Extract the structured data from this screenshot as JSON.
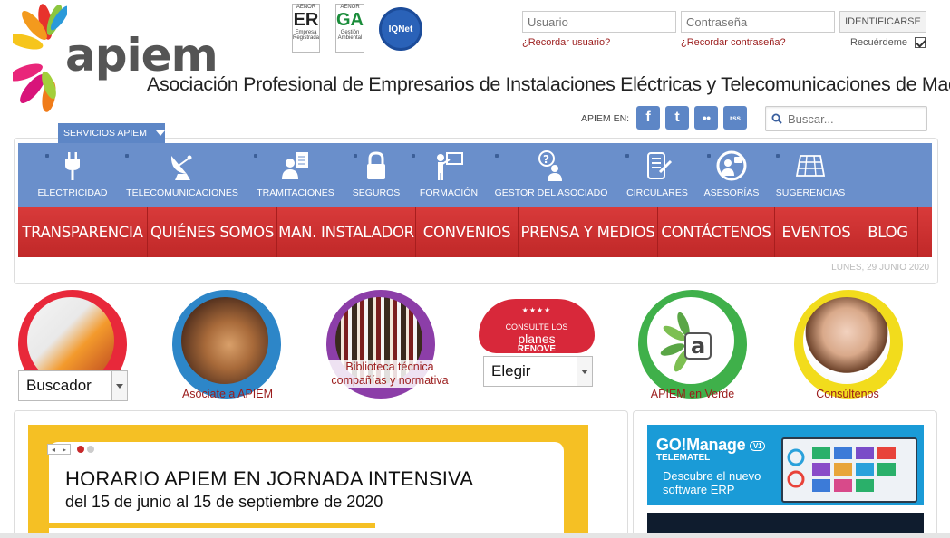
{
  "header": {
    "logo_text": "apiem",
    "tagline": "Asociación Profesional de Empresarios de Instalaciones Eléctricas y Telecomunicaciones de Madrid"
  },
  "certs": {
    "er_top": "AENOR",
    "er_big": "ER",
    "er_bottom": "Empresa Registrada",
    "ga_top": "AENOR",
    "ga_big": "GA",
    "ga_bottom": "Gestión Ambiental",
    "iq": "IQNet"
  },
  "login": {
    "user_placeholder": "Usuario",
    "pass_placeholder": "Contraseña",
    "submit_label": "IDENTIFICARSE",
    "forgot_user": "¿Recordar usuario?",
    "forgot_pass": "¿Recordar contraseña?",
    "remember_label": "Recuérdeme",
    "remember_checked": true
  },
  "social": {
    "label": "APIEM EN:",
    "facebook_icon": "f",
    "twitter_icon": "t",
    "flickr_icon": "●●",
    "rss_icon": "rss"
  },
  "search": {
    "placeholder": "Buscar..."
  },
  "services": {
    "toggle_label": "SERVICIOS APIEM",
    "items": [
      {
        "label": "ELECTRICIDAD",
        "icon": "plug-icon"
      },
      {
        "label": "TELECOMUNICACIONES",
        "icon": "satellite-dish-icon"
      },
      {
        "label": "TRAMITACIONES",
        "icon": "document-person-icon"
      },
      {
        "label": "SEGUROS",
        "icon": "lock-icon"
      },
      {
        "label": "FORMACIÓN",
        "icon": "teacher-icon"
      },
      {
        "label": "GESTOR DEL ASOCIADO",
        "icon": "question-person-icon"
      },
      {
        "label": "CIRCULARES",
        "icon": "newsletter-icon"
      },
      {
        "label": "ASESORÍAS",
        "icon": "advisor-icon"
      },
      {
        "label": "SUGERENCIAS",
        "icon": "solar-panel-icon"
      }
    ]
  },
  "main_nav": {
    "items": [
      "TRANSPARENCIA",
      "QUIÉNES SOMOS",
      "MAN. INSTALADOR",
      "CONVENIOS",
      "PRENSA Y MEDIOS",
      "CONTÁCTENOS",
      "EVENTOS",
      "BLOG"
    ]
  },
  "date": "LUNES, 29 JUNIO 2020",
  "circles": {
    "buscador_select": "Buscador",
    "asociate": "Asóciate a APIEM",
    "biblioteca": "Biblioteca técnica compañías y normativa",
    "planes_consulte": "CONSULTE LOS",
    "planes_word": "planes",
    "planes_renove": "RENOVE",
    "elegir_select": "Elegir",
    "verde": "APIEM en Verde",
    "consultenos": "Consúltenos"
  },
  "slider": {
    "headline": "HORARIO APIEM EN JORNADA INTENSIVA",
    "subheadline": "del 15 de junio al 15 de septiembre de 2020"
  },
  "ads": {
    "ad1_brand": "GO!Manage",
    "ad1_badge": "V1",
    "ad1_company": "TELEMATEL",
    "ad1_line1": "Descubre el nuevo",
    "ad1_line2": "software ERP"
  },
  "colors": {
    "service_blue": "#6a8fcb",
    "nav_red": "#c83030",
    "link_red": "#9b1c1c",
    "slider_yellow": "#f5c024"
  }
}
